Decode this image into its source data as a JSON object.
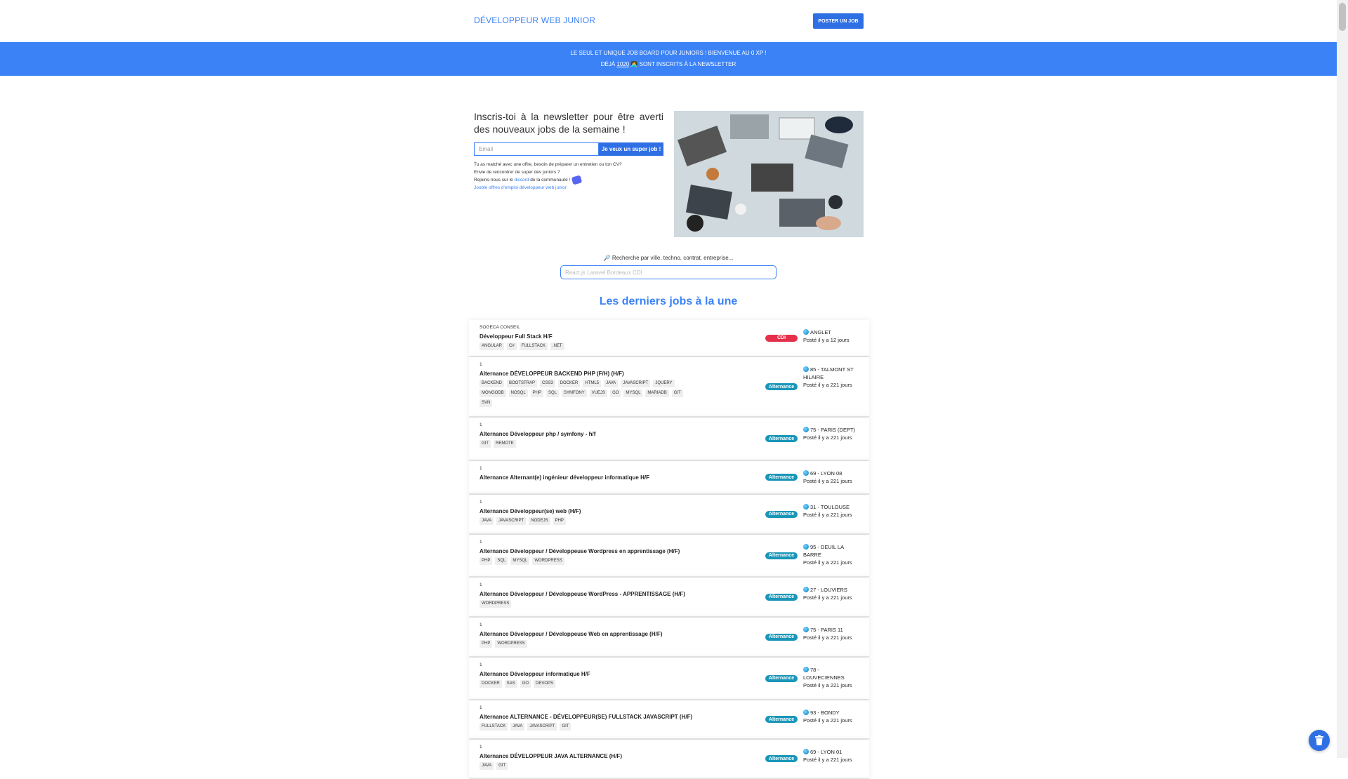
{
  "header": {
    "brand": "DÉVELOPPEUR WEB JUNIOR",
    "post_job_label": "POSTER UN JOB"
  },
  "banner": {
    "line1": "LE SEUL ET UNIQUE JOB BOARD POUR JUNIORS ! BIENVENUE AU 0 XP !",
    "line2_prefix": "DÉJÀ ",
    "count": "1020",
    "line2_suffix": " 🧑‍💻 SONT INSCRITS À LA NEWSLETTER"
  },
  "newsletter": {
    "title": "Inscris-toi à la newsletter pour être averti des nouveaux jobs de la semaine !",
    "email_placeholder": "Email",
    "submit_label": "Je veux un super job !",
    "info1": "Tu as matché avec une offre, besoin de préparer un entretien ou ton CV?",
    "info2": "Envie de rencontrer de super dev juniors ?",
    "info3_prefix": "Rejoins-nous sur le ",
    "info3_link": "discord",
    "info3_suffix": " de la communauté !",
    "jooble_link": "Jooble offres d'emploi développeur web junior"
  },
  "search": {
    "label": "🔎 Recherche par ville, techno, contrat, entreprise...",
    "placeholder": "React.js Laravel Bordeaux CDI"
  },
  "section_title": "Les derniers jobs à la une",
  "colors": {
    "primary": "#3b82f6",
    "cdi": "#e5304b",
    "alternance": "#1996b8"
  },
  "jobs": [
    {
      "company": "SOGECA CONSEIL",
      "title": "Développeur Full Stack H/F",
      "tags": [
        "ANGULAR",
        "C#",
        "FULLSTACK",
        ".NET"
      ],
      "contract": "CDI",
      "location": "ANGLET",
      "posted": "Posté il y a 12 jours"
    },
    {
      "company": "1",
      "title": "Alternance DÉVELOPPEUR BACKEND PHP (F/H) (H/F)",
      "tags": [
        "BACKEND",
        "BOOTSTRAP",
        "CSS3",
        "DOCKER",
        "HTML5",
        "JAVA",
        "JAVASCRIPT",
        "JQUERY",
        "MONGODB",
        "NOSQL",
        "PHP",
        "SQL",
        "SYMFONY",
        "VUEJS",
        "GO",
        "MYSQL",
        "MARIADB",
        "GIT",
        "SVN"
      ],
      "contract": "Alternance",
      "location": "85 - TALMONT ST HILAIRE",
      "posted": "Posté il y a 221 jours"
    },
    {
      "company": "1",
      "title": "Alternance Développeur php / symfony - h/f",
      "tags": [
        "GIT",
        "REMOTE"
      ],
      "contract": "Alternance",
      "location": "75 - PARIS (DEPT)",
      "posted": "Posté il y a 221 jours"
    },
    {
      "company": "1",
      "title": "Alternance Alternant(e) ingénieur développeur informatique H/F",
      "tags": [],
      "contract": "Alternance",
      "location": "69 - LYON 08",
      "posted": "Posté il y a 221 jours"
    },
    {
      "company": "1",
      "title": "Alternance Développeur(se) web (H/F)",
      "tags": [
        "JAVA",
        "JAVASCRIPT",
        "NODEJS",
        "PHP"
      ],
      "contract": "Alternance",
      "location": "31 - TOULOUSE",
      "posted": "Posté il y a 221 jours"
    },
    {
      "company": "1",
      "title": "Alternance Développeur / Développeuse Wordpress en apprentissage (H/F)",
      "tags": [
        "PHP",
        "SQL",
        "MYSQL",
        "WORDPRESS"
      ],
      "contract": "Alternance",
      "location": "95 - DEUIL LA BARRE",
      "posted": "Posté il y a 221 jours"
    },
    {
      "company": "1",
      "title": "Alternance Développeur / Développeuse WordPress - APPRENTISSAGE (H/F)",
      "tags": [
        "WORDPRESS"
      ],
      "contract": "Alternance",
      "location": "27 - LOUVIERS",
      "posted": "Posté il y a 221 jours"
    },
    {
      "company": "1",
      "title": "Alternance Développeur / Développeuse Web en apprentissage (H/F)",
      "tags": [
        "PHP",
        "WORDPRESS"
      ],
      "contract": "Alternance",
      "location": "75 - PARIS 11",
      "posted": "Posté il y a 221 jours"
    },
    {
      "company": "1",
      "title": "Alternance Développeur informatique H/F",
      "tags": [
        "DOCKER",
        "SAS",
        "GO",
        "DEVOPS"
      ],
      "contract": "Alternance",
      "location": "78 - LOUVECIENNES",
      "posted": "Posté il y a 221 jours"
    },
    {
      "company": "1",
      "title": "Alternance ALTERNANCE - DÉVELOPPEUR(SE) FULLSTACK JAVASCRIPT (H/F)",
      "tags": [
        "FULLSTACK",
        "JAVA",
        "JAVASCRIPT",
        "GIT"
      ],
      "contract": "Alternance",
      "location": "93 - BONDY",
      "posted": "Posté il y a 221 jours"
    },
    {
      "company": "1",
      "title": "Alternance DÉVELOPPEUR JAVA ALTERNANCE (H/F)",
      "tags": [
        "JAVA",
        "GIT"
      ],
      "contract": "Alternance",
      "location": "69 - LYON 01",
      "posted": "Posté il y a 221 jours"
    }
  ]
}
